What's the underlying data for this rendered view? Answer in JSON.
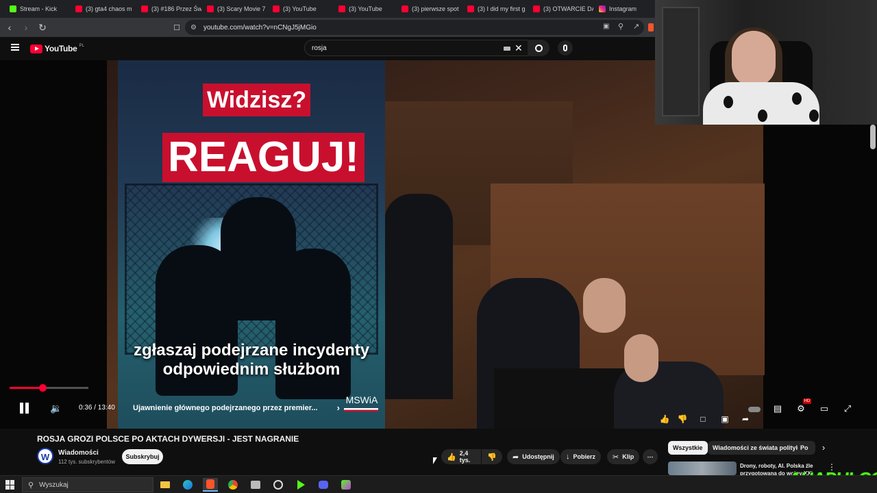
{
  "browser": {
    "tabs": [
      {
        "label": "Stream - Kick",
        "favicon": "kick"
      },
      {
        "label": "(3) gta4 chaos m",
        "favicon": "yt"
      },
      {
        "label": "(3) #186 Przez Św",
        "favicon": "yt"
      },
      {
        "label": "(3) Scary Movie 7",
        "favicon": "yt"
      },
      {
        "label": "(3) YouTube",
        "favicon": "yt"
      },
      {
        "label": "(3) YouTube",
        "favicon": "yt"
      },
      {
        "label": "(3) pierwsze spot",
        "favicon": "yt"
      },
      {
        "label": "(3) I did my first g",
        "favicon": "yt"
      },
      {
        "label": "(3) OTWARCIE DA",
        "favicon": "yt"
      },
      {
        "label": "Instagram",
        "favicon": "ig"
      }
    ],
    "url": "youtube.com/watch?v=nCNgJ5jMGio"
  },
  "youtube": {
    "logo_text": "YouTube",
    "country_code": "PL",
    "search_query": "rosja"
  },
  "video": {
    "poster_label_1": "Widzisz?",
    "poster_label_2": "REAGUJ!",
    "poster_caption": "zgłaszaj podejrzane incydenty odpowiednim służbom",
    "brand": "MSWiA",
    "progress": 0.044,
    "time": "0:36 / 13:40",
    "chapter": "Ujawnienie głównego podejrzanego przez premier...",
    "hd_badge": "HD"
  },
  "info": {
    "title": "ROSJA GROZI POLSCE PO AKTACH DYWERSJI - JEST NAGRANIE",
    "channel_initial": "W",
    "channel_name": "Wiadomości",
    "channel_subs": "112 tys. subskrybentów",
    "subscribe": "Subskrybuj",
    "likes": "2,4 tys.",
    "share": "Udostępnij",
    "download": "Pobierz",
    "clip": "Klip",
    "more": "⋯"
  },
  "chips": [
    "Wszystkie",
    "Wiadomości ze świata polityki",
    "Po"
  ],
  "recommendation": {
    "title": "Drony, roboty, AI. Polska źle przygotowana do wojny XXI"
  },
  "watermark": "AHAPULCO",
  "taskbar": {
    "search_placeholder": "Wyszukaj"
  },
  "colors": {
    "youtube_red": "#ff0033",
    "kick_green": "#53fc18",
    "poster_red": "#c8102e"
  }
}
